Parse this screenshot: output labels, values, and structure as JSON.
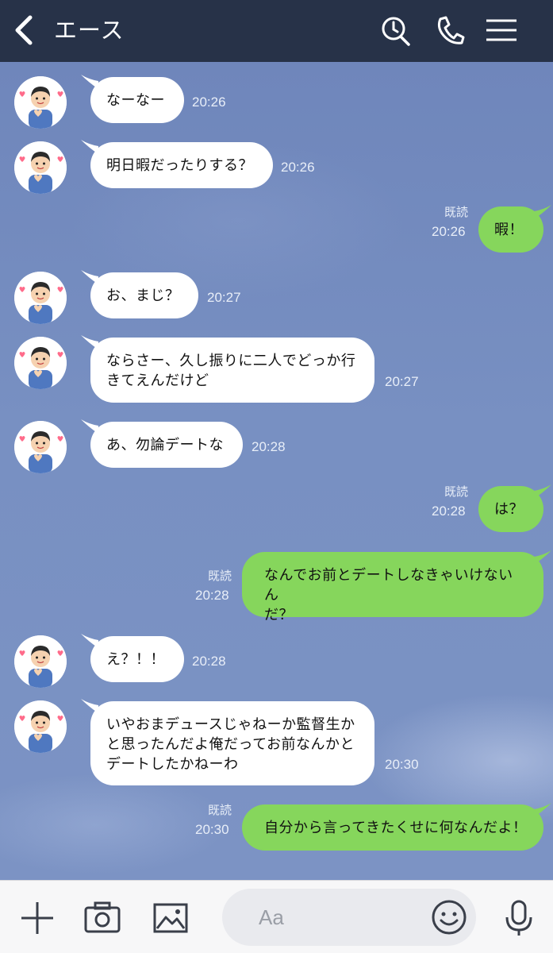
{
  "header": {
    "title": "エース",
    "icons": [
      "back-arrow-icon",
      "search-icon",
      "phone-icon",
      "menu-icon"
    ],
    "background": "#273248"
  },
  "chat": {
    "messages": [
      {
        "side": "in",
        "text": "なーなー",
        "time": "20:26"
      },
      {
        "side": "in",
        "text": "明日暇だったりする？",
        "time": "20:26"
      },
      {
        "side": "out",
        "text": "暇！",
        "time": "20:26",
        "read": "既読"
      },
      {
        "side": "in",
        "text": "お、まじ？",
        "time": "20:27"
      },
      {
        "side": "in",
        "lines": [
          "ならさー、久し振りに二人でどっか行",
          "きてえんだけど"
        ],
        "time": "20:27"
      },
      {
        "side": "in",
        "text": "あ、勿論デートな",
        "time": "20:28"
      },
      {
        "side": "out",
        "text": "は？",
        "time": "20:28",
        "read": "既読"
      },
      {
        "side": "out",
        "lines": [
          "なんでお前とデートしなきゃいけないん",
          "だ？"
        ],
        "time": "20:28",
        "read": "既読"
      },
      {
        "side": "in",
        "text": "え？！！",
        "time": "20:28"
      },
      {
        "side": "in",
        "lines": [
          "いやおまデュースじゃねーか監督生か",
          "と思ったんだよ俺だってお前なんかと",
          "デートしたかねーわ"
        ],
        "time": "20:30"
      },
      {
        "side": "out",
        "text": "自分から言ってきたくせに何なんだよ！",
        "time": "20:30",
        "read": "既読"
      }
    ],
    "colors": {
      "incoming": "#ffffff",
      "outgoing": "#86d65c",
      "background": "#7189bd"
    }
  },
  "footer": {
    "input_placeholder": "Aa",
    "icons": [
      "plus-icon",
      "camera-icon",
      "image-icon",
      "emoji-icon",
      "microphone-icon"
    ]
  }
}
